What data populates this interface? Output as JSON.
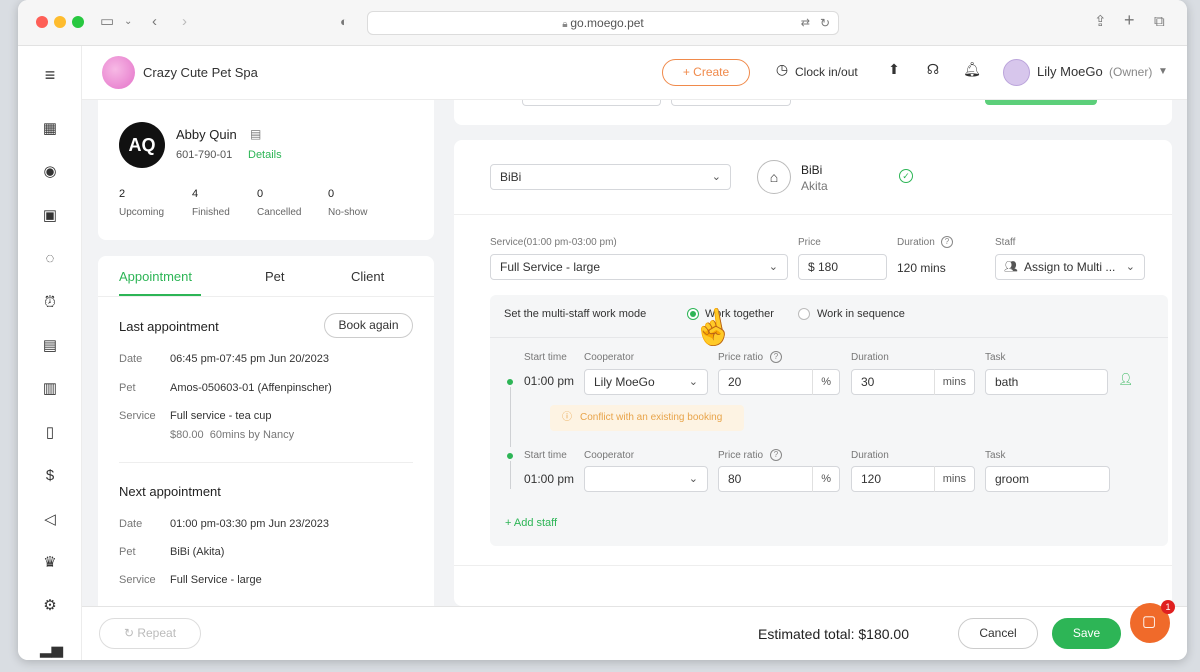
{
  "browser": {
    "url": "go.moego.pet"
  },
  "header": {
    "brand_name": "Crazy Cute Pet Spa",
    "create_label": "+ Create",
    "clock_label": "Clock in/out",
    "user_name": "Lily MoeGo",
    "user_role": "(Owner)"
  },
  "client": {
    "initials": "AQ",
    "name": "Abby Quin",
    "phone": "601-790-01",
    "details_link": "Details",
    "stats": [
      {
        "value": "2",
        "label": "Upcoming"
      },
      {
        "value": "4",
        "label": "Finished"
      },
      {
        "value": "0",
        "label": "Cancelled"
      },
      {
        "value": "0",
        "label": "No-show"
      }
    ]
  },
  "tabs": [
    {
      "label": "Appointment",
      "active": true
    },
    {
      "label": "Pet",
      "active": false
    },
    {
      "label": "Client",
      "active": false
    }
  ],
  "last_appointment": {
    "title": "Last appointment",
    "book_again": "Book again",
    "date_label": "Date",
    "date": "06:45 pm-07:45 pm Jun 20/2023",
    "pet_label": "Pet",
    "pet": "Amos-050603-01 (Affenpinscher)",
    "service_label": "Service",
    "service": "Full service - tea cup",
    "service_detail": "$80.00  60mins by Nancy"
  },
  "next_appointment": {
    "title": "Next appointment",
    "date_label": "Date",
    "date": "01:00 pm-03:30 pm Jun 23/2023",
    "pet_label": "Pet",
    "pet": "BiBi (Akita)",
    "service_label": "Service",
    "service": "Full Service - large"
  },
  "pet_section": {
    "pet_select": "BiBi",
    "pet_name": "BiBi",
    "pet_breed": "Akita"
  },
  "service_row": {
    "service_label": "Service(01:00 pm-03:00 pm)",
    "service_value": "Full Service - large",
    "price_label": "Price",
    "price_value": "$ 180",
    "duration_label": "Duration",
    "duration_value": "120 mins",
    "staff_label": "Staff",
    "staff_value": "Assign to Multi ..."
  },
  "multi_staff": {
    "mode_label": "Set the multi-staff work mode",
    "option_together": "Work together",
    "option_sequence": "Work in sequence",
    "selected": "together",
    "rows": [
      {
        "start_label": "Start time",
        "start": "01:00 pm",
        "coop_label": "Cooperator",
        "coop": "Lily MoeGo",
        "ratio_label": "Price ratio",
        "ratio": "20",
        "ratio_unit": "%",
        "dur_label": "Duration",
        "dur": "30",
        "dur_unit": "mins",
        "task_label": "Task",
        "task": "bath"
      },
      {
        "start_label": "Start time",
        "start": "01:00 pm",
        "coop_label": "Cooperator",
        "coop": "",
        "ratio_label": "Price ratio",
        "ratio": "80",
        "ratio_unit": "%",
        "dur_label": "Duration",
        "dur": "120",
        "dur_unit": "mins",
        "task_label": "Task",
        "task": "groom"
      }
    ],
    "conflict": "Conflict with an existing booking",
    "add_staff": "+ Add staff"
  },
  "footer": {
    "repeat": "Repeat",
    "estimated_total": "Estimated total: $180.00",
    "cancel": "Cancel",
    "save": "Save",
    "chat_badge": "1"
  },
  "colors": {
    "accent_green": "#2db556",
    "accent_orange": "#f08a4b"
  }
}
